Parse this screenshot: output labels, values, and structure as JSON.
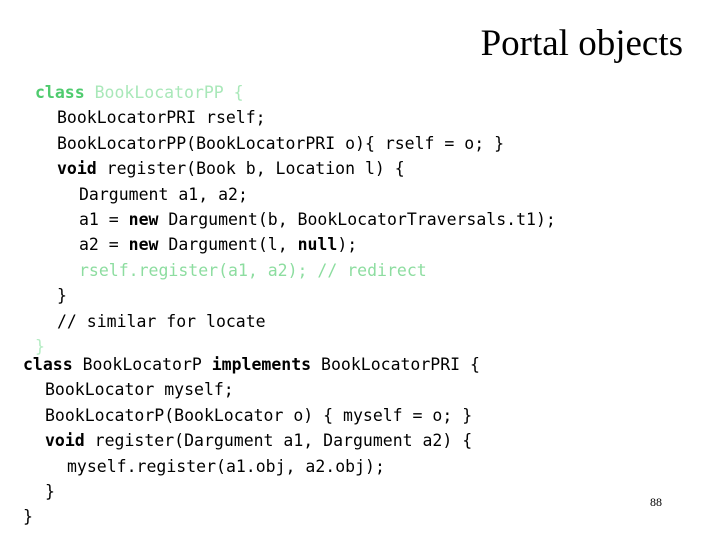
{
  "slide": {
    "title": "Portal objects",
    "page_number": "88",
    "colors": {
      "background": "#ffffff",
      "text": "#000000",
      "green_keyword": "#4fcb6e",
      "green_light": "#a9e8b9",
      "green_mid": "#8ddda0"
    }
  },
  "code_block_1": {
    "lines": [
      {
        "indent": 0,
        "tokens": [
          {
            "text": "class",
            "style": "green-kw"
          },
          {
            "text": " BookLocatorPP {",
            "style": "green-light"
          }
        ]
      },
      {
        "indent": 1,
        "tokens": [
          {
            "text": "BookLocatorPRI rself;",
            "style": "plain"
          }
        ]
      },
      {
        "indent": 1,
        "tokens": [
          {
            "text": "BookLocatorPP(BookLocatorPRI o){ rself = o; }",
            "style": "plain"
          }
        ]
      },
      {
        "indent": 1,
        "tokens": [
          {
            "text": "void",
            "style": "kw"
          },
          {
            "text": " register(Book b, Location l) {",
            "style": "plain"
          }
        ]
      },
      {
        "indent": 2,
        "tokens": [
          {
            "text": "Dargument a1, a2;",
            "style": "plain"
          }
        ]
      },
      {
        "indent": 2,
        "tokens": [
          {
            "text": "a1 = ",
            "style": "plain"
          },
          {
            "text": "new",
            "style": "kw"
          },
          {
            "text": " Dargument(b, BookLocatorTraversals.t1);",
            "style": "plain"
          }
        ]
      },
      {
        "indent": 2,
        "tokens": [
          {
            "text": "a2 = ",
            "style": "plain"
          },
          {
            "text": "new",
            "style": "kw"
          },
          {
            "text": " Dargument(l, ",
            "style": "plain"
          },
          {
            "text": "null",
            "style": "kw"
          },
          {
            "text": ");",
            "style": "plain"
          }
        ]
      },
      {
        "indent": 2,
        "tokens": [
          {
            "text": "rself.register(a1, a2); // redirect",
            "style": "green-mid"
          }
        ]
      },
      {
        "indent": 1,
        "tokens": [
          {
            "text": "}",
            "style": "plain"
          }
        ]
      },
      {
        "indent": 1,
        "tokens": [
          {
            "text": "// similar for locate",
            "style": "plain"
          }
        ]
      },
      {
        "indent": 0,
        "tokens": [
          {
            "text": "}",
            "style": "green-brace"
          }
        ]
      }
    ]
  },
  "code_block_2": {
    "lines": [
      {
        "indent": 0,
        "tokens": [
          {
            "text": "class",
            "style": "kw"
          },
          {
            "text": " BookLocatorP ",
            "style": "plain"
          },
          {
            "text": "implements",
            "style": "kw"
          },
          {
            "text": " BookLocatorPRI {",
            "style": "plain"
          }
        ]
      },
      {
        "indent": 1,
        "tokens": [
          {
            "text": "BookLocator myself;",
            "style": "plain"
          }
        ]
      },
      {
        "indent": 1,
        "tokens": [
          {
            "text": "BookLocatorP(BookLocator o) { myself = o; }",
            "style": "plain"
          }
        ]
      },
      {
        "indent": 1,
        "tokens": [
          {
            "text": "void",
            "style": "kw"
          },
          {
            "text": " register(Dargument a1, Dargument a2) {",
            "style": "plain"
          }
        ]
      },
      {
        "indent": 2,
        "tokens": [
          {
            "text": "myself.register(a1.obj, a2.obj);",
            "style": "plain"
          }
        ]
      },
      {
        "indent": 1,
        "tokens": [
          {
            "text": "}",
            "style": "plain"
          }
        ]
      },
      {
        "indent": 0,
        "tokens": [
          {
            "text": "}",
            "style": "plain"
          }
        ]
      }
    ]
  }
}
